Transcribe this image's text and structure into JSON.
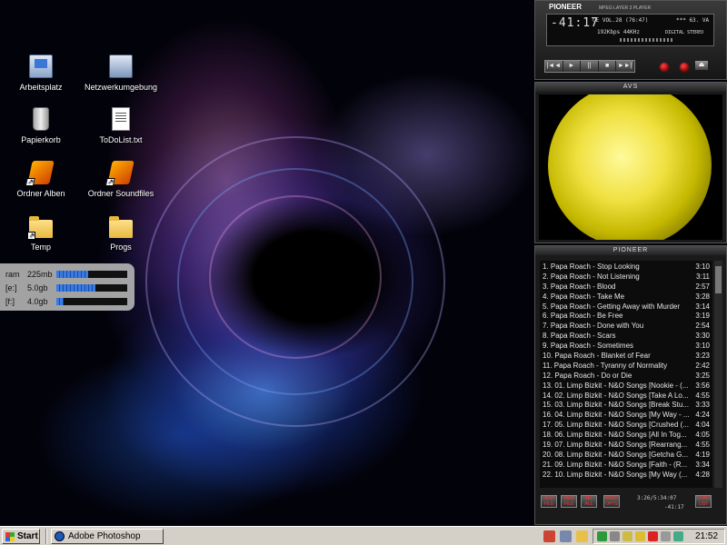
{
  "desktop": {
    "icons": [
      {
        "label": "Arbeitsplatz",
        "icon": "computer-icon"
      },
      {
        "label": "Netzwerkumgebung",
        "icon": "network-icon"
      },
      {
        "label": "Papierkorb",
        "icon": "recycle-bin-icon"
      },
      {
        "label": "ToDoList.txt",
        "icon": "text-file-icon"
      },
      {
        "label": "Ordner Alben",
        "icon": "winamp-shortcut-icon"
      },
      {
        "label": "Ordner Soundfiles",
        "icon": "winamp-shortcut-icon"
      },
      {
        "label": "Temp",
        "icon": "folder-shortcut-icon"
      },
      {
        "label": "Progs",
        "icon": "folder-icon"
      }
    ]
  },
  "sysmon": {
    "rows": [
      {
        "label": "ram",
        "value": "225mb",
        "fill": 0.45
      },
      {
        "label": "[e:]",
        "value": "5.0gb",
        "fill": 0.55
      },
      {
        "label": "[f:]",
        "value": "4.0gb",
        "fill": 0.1
      }
    ]
  },
  "player": {
    "brand": "PIONEER",
    "subtitle": "MPEG LAYER 3 PLAYER",
    "time": "-41:17",
    "track_info": "CE VOL.28 (76:47)",
    "stars": "*** 63. VA",
    "bitrate": "192Kbps 44KHz",
    "mode": "DIGITAL STEREO",
    "transport": [
      "|◄◄",
      "►",
      "||",
      "■",
      "►►|"
    ]
  },
  "vis": {
    "title": "AVS"
  },
  "playlist": {
    "brand": "PIONEER",
    "items": [
      {
        "title": "1. Papa Roach - Stop Looking",
        "time": "3:10"
      },
      {
        "title": "2. Papa Roach - Not Listening",
        "time": "3:11"
      },
      {
        "title": "3. Papa Roach - Blood",
        "time": "2:57"
      },
      {
        "title": "4. Papa Roach - Take Me",
        "time": "3:28"
      },
      {
        "title": "5. Papa Roach - Getting Away with Murder",
        "time": "3:14"
      },
      {
        "title": "6. Papa Roach - Be Free",
        "time": "3:19"
      },
      {
        "title": "7. Papa Roach - Done with You",
        "time": "2:54"
      },
      {
        "title": "8. Papa Roach - Scars",
        "time": "3:30"
      },
      {
        "title": "9. Papa Roach - Sometimes",
        "time": "3:10"
      },
      {
        "title": "10. Papa Roach - Blanket of Fear",
        "time": "3:23"
      },
      {
        "title": "11. Papa Roach - Tyranny of Normality",
        "time": "2:42"
      },
      {
        "title": "12. Papa Roach - Do or Die",
        "time": "3:25"
      },
      {
        "title": "13. 01. Limp Bizkit - N&O Songs [Nookie - (...",
        "time": "3:56"
      },
      {
        "title": "14. 02. Limp Bizkit - N&O Songs [Take A Lo...",
        "time": "4:55"
      },
      {
        "title": "15. 03. Limp Bizkit - N&O Songs [Break Stu...",
        "time": "3:33"
      },
      {
        "title": "16. 04. Limp Bizkit - N&O Songs [My Way - ...",
        "time": "4:24"
      },
      {
        "title": "17. 05. Limp Bizkit - N&O Songs [Crushed (...",
        "time": "4:04"
      },
      {
        "title": "18. 06. Limp Bizkit - N&O Songs [All In Tog...",
        "time": "4:05"
      },
      {
        "title": "19. 07. Limp Bizkit - N&O Songs [Rearrang...",
        "time": "4:55"
      },
      {
        "title": "20. 08. Limp Bizkit - N&O Songs [Getcha G...",
        "time": "4:19"
      },
      {
        "title": "21. 09. Limp Bizkit - N&O Songs [Faith - (R...",
        "time": "3:34"
      },
      {
        "title": "22. 10. Limp Bizkit - N&O Songs [My Way (...",
        "time": "4:28"
      }
    ],
    "buttons": [
      "ADD FILE",
      "REM FILE",
      "SEL ALL",
      "MISC OPTS",
      "LOAD LIST"
    ],
    "time_display": "3:26/5:34:07",
    "remaining": "-41:17"
  },
  "taskbar": {
    "start_label": "Start",
    "task_label": "Adobe Photoshop",
    "clock": "21:52"
  },
  "colors": {
    "taskbar": "#d4d0c8",
    "accent_red": "#ff3333",
    "vis_yellow": "#f0e040"
  }
}
